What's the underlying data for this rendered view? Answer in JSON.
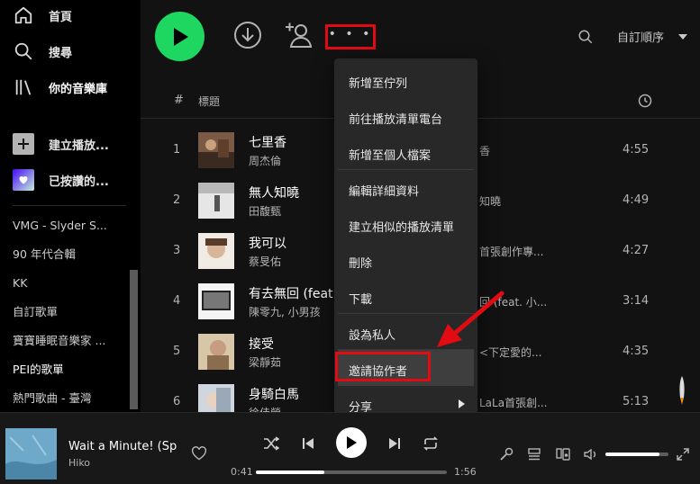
{
  "sidebar": {
    "nav": {
      "home": "首頁",
      "search": "搜尋",
      "library": "你的音樂庫"
    },
    "actions": {
      "create": "建立播放...",
      "liked": "已按讚的..."
    },
    "playlists": [
      "VMG - Slyder S...",
      "90 年代合輯",
      "KK",
      "自訂歌單",
      "寶寶睡眠音樂家 ...",
      "PEI的歌單",
      "熱門歌曲 - 臺灣"
    ]
  },
  "toolbar": {
    "more_label": "• • •",
    "sort_label": "自訂順序"
  },
  "header": {
    "hash": "#",
    "title_col": "標題"
  },
  "tracks": [
    {
      "num": "1",
      "title": "七里香",
      "artist": "周杰倫",
      "album": "香",
      "duration": "4:55"
    },
    {
      "num": "2",
      "title": "無人知曉",
      "artist": "田馥甄",
      "album": "知曉",
      "duration": "4:49"
    },
    {
      "num": "3",
      "title": "我可以",
      "artist": "蔡旻佑",
      "album": "首張創作專...",
      "duration": "4:27"
    },
    {
      "num": "4",
      "title": "有去無回 (feat",
      "artist": "陳零九, 小男孩",
      "album": "回 (feat. 小...",
      "duration": "3:14"
    },
    {
      "num": "5",
      "title": "接受",
      "artist": "梁靜茹",
      "album": "<下定愛的...",
      "duration": "4:35"
    },
    {
      "num": "6",
      "title": "身騎白馬",
      "artist": "徐佳瑩",
      "album": "LaLa首張創...",
      "duration": "5:13"
    }
  ],
  "context_menu": {
    "items": [
      "新增至佇列",
      "前往播放清單電台",
      "新增至個人檔案",
      "編輯詳細資料",
      "建立相似的播放清單",
      "刪除",
      "下載",
      "設為私人",
      "邀請協作者",
      "分享"
    ],
    "highlighted_index": 8
  },
  "now_playing": {
    "title": "Wait a Minute! (Sp",
    "artist": "Hiko",
    "time_current": "0:41",
    "time_total": "1:56",
    "progress_fraction": 0.36,
    "volume_fraction": 0.85
  },
  "colors": {
    "accent": "#1ed760",
    "highlight_box": "#e30b12"
  }
}
